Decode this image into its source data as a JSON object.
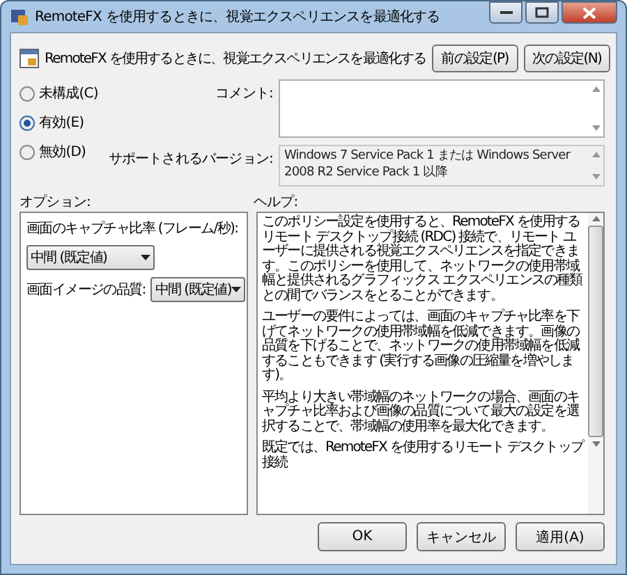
{
  "window": {
    "title": "RemoteFX を使用するときに、視覚エクスペリエンスを最適化する"
  },
  "heading": "RemoteFX を使用するときに、視覚エクスペリエンスを最適化する",
  "nav_buttons": [
    "前の設定(P)",
    "次の設定(N)"
  ],
  "state_options": [
    {
      "label": "未構成(C)",
      "selected": false
    },
    {
      "label": "有効(E)",
      "selected": true
    },
    {
      "label": "無効(D)",
      "selected": false
    }
  ],
  "comment": {
    "label": "コメント:"
  },
  "supported": {
    "label": "サポートされるバージョン:",
    "value": "Windows 7 Service Pack 1 または Windows Server 2008 R2 Service Pack 1 以降"
  },
  "options_label": "オプション:",
  "help_label": "ヘルプ:",
  "options": [
    {
      "label": "画面のキャプチャ比率 (フレーム/秒):",
      "value": "中間 (既定値)",
      "kind": "stacked"
    },
    {
      "label": "画面イメージの品質:",
      "value": "中間 (既定値)",
      "kind": "inline"
    }
  ],
  "help_paragraphs": [
    "このポリシー設定を使用すると、RemoteFX を使用するリモート デスクトップ接続 (RDC) 接続で、リモート ユーザーに提供される視覚エクスペリエンスを指定できます。このポリシーを使用して、ネットワークの使用帯域幅と提供されるグラフィックス エクスペリエンスの種類との間でバランスをとることができます。",
    "ユーザーの要件によっては、画面のキャプチャ比率を下げてネットワークの使用帯域幅を低減できます。画像の品質を下げることで、ネットワークの使用帯域幅を低減することもできます (実行する画像の圧縮量を増やします)。",
    "平均より大きい帯域幅のネットワークの場合、画面のキャプチャ比率および画像の品質について最大の設定を選択することで、帯域幅の使用率を最大化できます。",
    "既定では、RemoteFX を使用するリモート デスクトップ接続"
  ],
  "footer_buttons": [
    "OK",
    "キャンセル",
    "適用(A)"
  ]
}
